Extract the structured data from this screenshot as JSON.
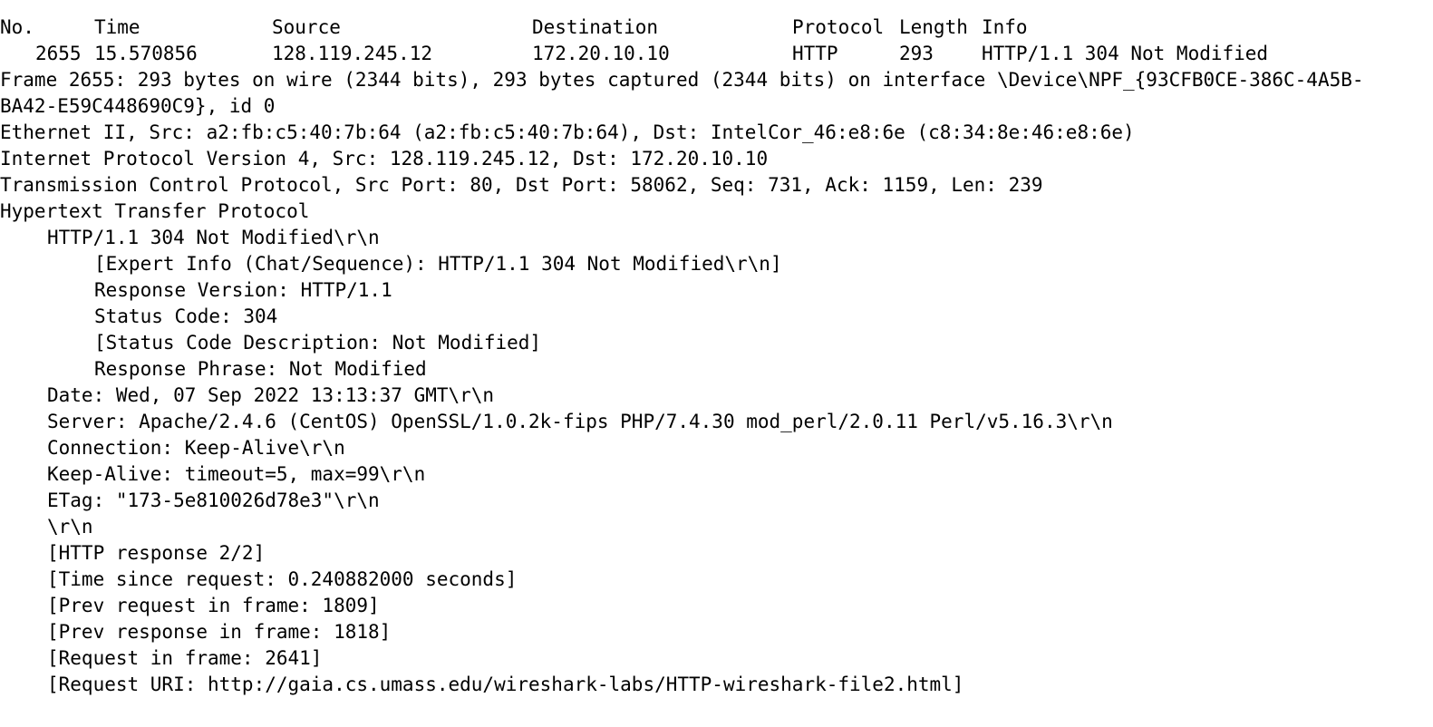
{
  "header": {
    "no": "No.",
    "time": "Time",
    "source": "Source",
    "destination": "Destination",
    "protocol": "Protocol",
    "length": "Length",
    "info": "Info"
  },
  "packet_row": {
    "no": "2655",
    "time": "15.570856",
    "source": "128.119.245.12",
    "destination": "172.20.10.10",
    "protocol": "HTTP",
    "length": "293",
    "info": "HTTP/1.1 304 Not Modified"
  },
  "details": {
    "frame_line1": "Frame 2655: 293 bytes on wire (2344 bits), 293 bytes captured (2344 bits) on interface \\Device\\NPF_{93CFB0CE-386C-4A5B-",
    "frame_line2": "BA42-E59C448690C9}, id 0",
    "ethernet": "Ethernet II, Src: a2:fb:c5:40:7b:64 (a2:fb:c5:40:7b:64), Dst: IntelCor_46:e8:6e (c8:34:8e:46:e8:6e)",
    "ip": "Internet Protocol Version 4, Src: 128.119.245.12, Dst: 172.20.10.10",
    "tcp": "Transmission Control Protocol, Src Port: 80, Dst Port: 58062, Seq: 731, Ack: 1159, Len: 239",
    "http": "Hypertext Transfer Protocol",
    "status_line": "HTTP/1.1 304 Not Modified\\r\\n",
    "expert_info": "[Expert Info (Chat/Sequence): HTTP/1.1 304 Not Modified\\r\\n]",
    "response_version": "Response Version: HTTP/1.1",
    "status_code": "Status Code: 304",
    "status_desc": "[Status Code Description: Not Modified]",
    "response_phrase": "Response Phrase: Not Modified",
    "date": "Date: Wed, 07 Sep 2022 13:13:37 GMT\\r\\n",
    "server": "Server: Apache/2.4.6 (CentOS) OpenSSL/1.0.2k-fips PHP/7.4.30 mod_perl/2.0.11 Perl/v5.16.3\\r\\n",
    "connection": "Connection: Keep-Alive\\r\\n",
    "keep_alive": "Keep-Alive: timeout=5, max=99\\r\\n",
    "etag": "ETag: \"173-5e810026d78e3\"\\r\\n",
    "crlf": "\\r\\n",
    "http_response": "[HTTP response 2/2]",
    "time_since": "[Time since request: 0.240882000 seconds]",
    "prev_request": "[Prev request in frame: 1809]",
    "prev_response": "[Prev response in frame: 1818]",
    "request_in": "[Request in frame: 2641]",
    "request_uri": "[Request URI: http://gaia.cs.umass.edu/wireshark-labs/HTTP-wireshark-file2.html]"
  }
}
